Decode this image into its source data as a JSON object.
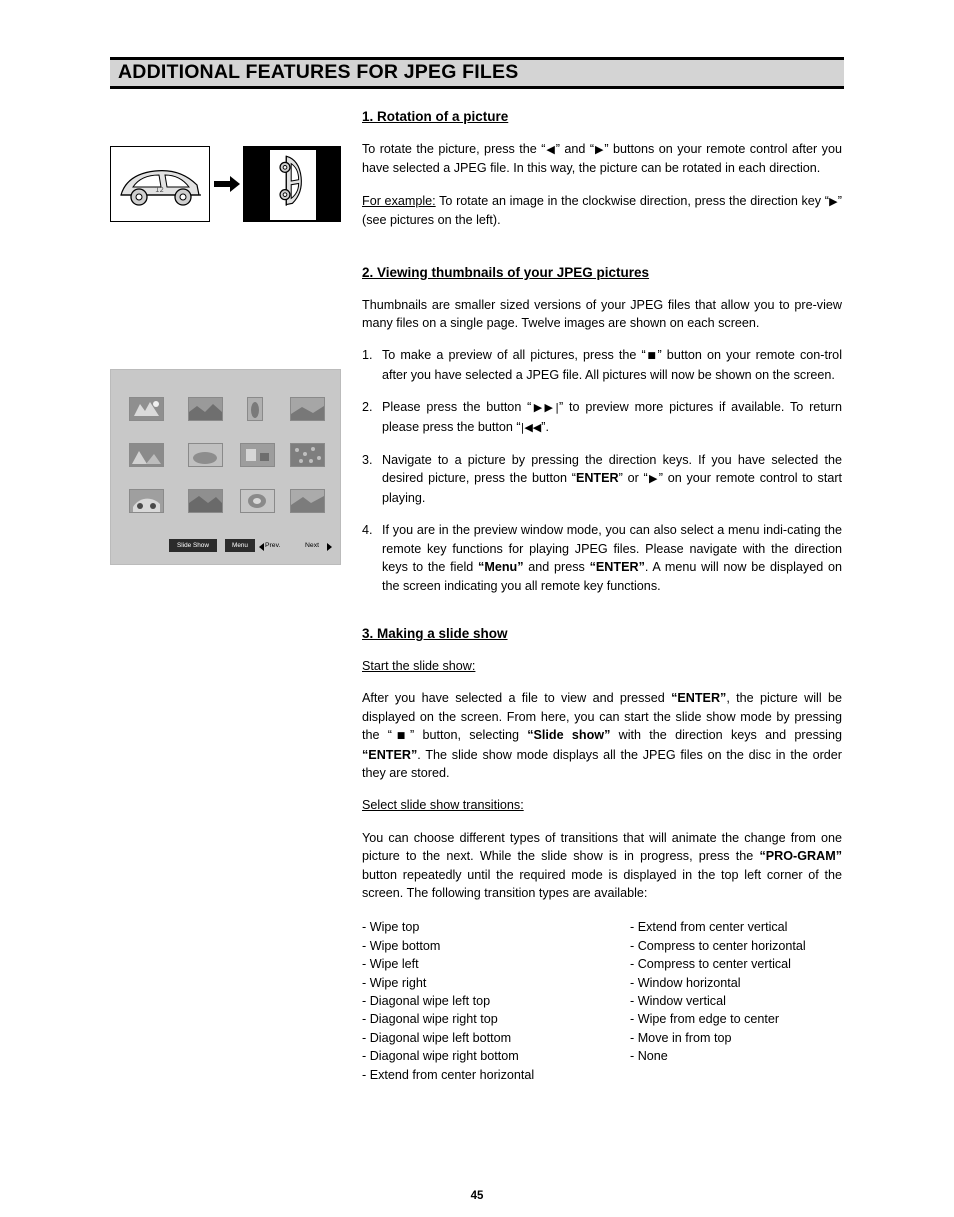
{
  "header": {
    "title": "ADDITIONAL FEATURES FOR JPEG FILES"
  },
  "sections": {
    "rotation": {
      "heading": "1. Rotation of a picture",
      "p1_a": "To rotate the picture, press the “",
      "p1_left_arrow": "◀",
      "p1_b": "” and “",
      "p1_right_arrow": "▶",
      "p1_c": "” buttons on your remote control after you have selected a JPEG file. In this way, the picture can be rotated in each direction.",
      "p2_label": "For example:",
      "p2_a": " To rotate an image in the clockwise direction, press the direction key “",
      "p2_arrow": "▶",
      "p2_b": "” (see pictures on the left)."
    },
    "thumbnails": {
      "heading": "2. Viewing thumbnails of your JPEG pictures",
      "intro": "Thumbnails are smaller sized versions of your JPEG files that allow you to pre-view many files on a single page. Twelve images are shown on each screen.",
      "items": [
        {
          "num": "1.",
          "a": "To make a preview of all pictures, press the “",
          "glyph": "■",
          "b": "” button on your remote con-trol after you have selected a JPEG file. All pictures will now be shown on the screen."
        },
        {
          "num": "2.",
          "a": "Please press the button “",
          "glyph": "▶▶|",
          "b": "” to preview more pictures if available. To return please press the button “",
          "glyph2": "|◀◀",
          "c": "”."
        },
        {
          "num": "3.",
          "a": "Navigate to a picture by pressing the direction keys. If you have selected the desired picture, press the button “",
          "bold1": "ENTER",
          "b": "” or “",
          "glyph": "▶",
          "c": "” on your remote control to start playing."
        },
        {
          "num": "4.",
          "a": "If you are in the preview  window  mode, you can also select a menu indi-cating the remote key functions for playing JPEG files. Please navigate with the direction keys to the field ",
          "bold1": "“Menu”",
          "b": " and press ",
          "bold2": "“ENTER”",
          "c": ".  A menu will now be displayed on the screen indicating you all remote key functions."
        }
      ]
    },
    "slideshow": {
      "heading": "3. Making a slide show",
      "sub1": "Start the slide show:",
      "p1_a": "After you have selected a file to view and pressed ",
      "p1_b1": "“ENTER”",
      "p1_b": ", the picture will be displayed on the screen. From here, you can start the slide show mode by pressing the “",
      "p1_glyph": "■",
      "p1_c": "” button, selecting ",
      "p1_b2": "“Slide show”",
      "p1_d": " with the direction keys and pressing ",
      "p1_b3": "“ENTER”",
      "p1_e": ". The slide show mode displays all the JPEG files on the disc in the order they are stored.",
      "sub2": "Select slide show transitions:",
      "p2_a": "You can choose different types of transitions that will animate the change from one picture to the next. While the slide show is in progress, press the ",
      "p2_b1": "“PRO-GRAM”",
      "p2_b": " button repeatedly until the required mode is displayed in the top left corner of the screen. The following transition types are available:",
      "transitions_left": [
        "- Wipe top",
        "- Wipe bottom",
        "- Wipe left",
        "- Wipe right",
        "- Diagonal wipe left top",
        "- Diagonal wipe right top",
        "- Diagonal wipe left bottom",
        "- Diagonal wipe right bottom",
        "- Extend from center horizontal"
      ],
      "transitions_right": [
        "- Extend from center vertical",
        "- Compress to center horizontal",
        "- Compress to center vertical",
        "- Window horizontal",
        "- Window vertical",
        "- Wipe from edge to center",
        "- Move in from top",
        "- None"
      ]
    }
  },
  "illustration": {
    "thumb_screen": {
      "slide_show_button": "Slide Show",
      "menu_button": "Menu",
      "prev_label": "Prev.",
      "next_label": "Next"
    }
  },
  "footer": {
    "page_number": "45"
  }
}
